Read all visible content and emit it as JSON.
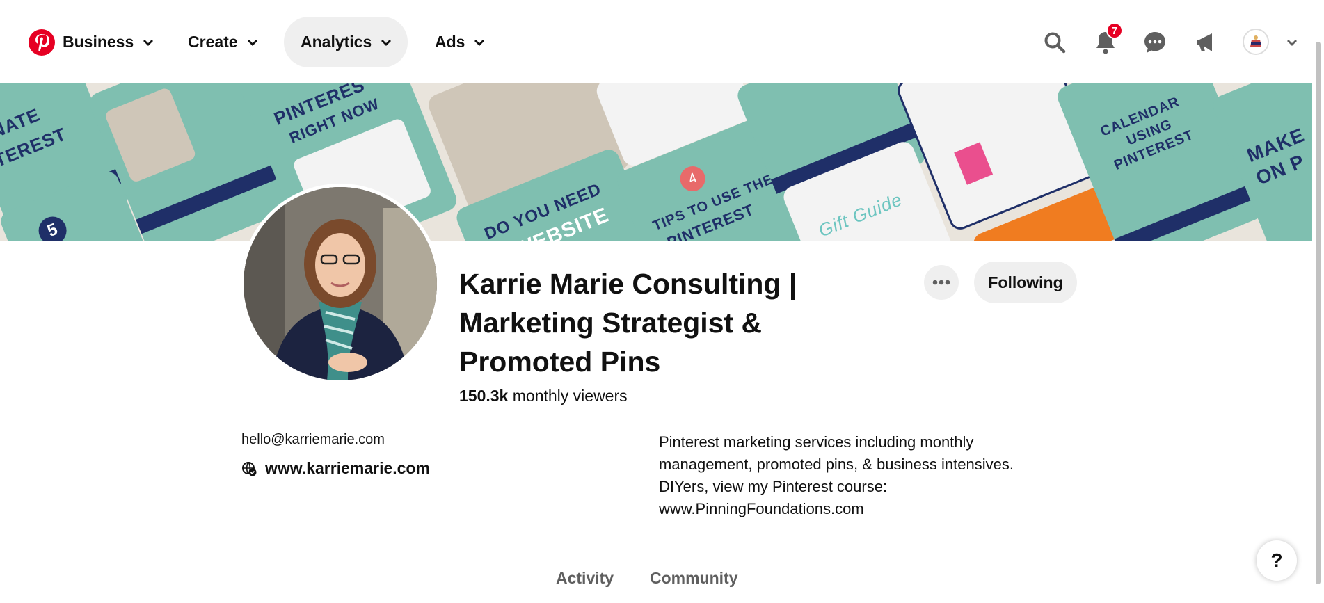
{
  "nav": {
    "business": "Business",
    "create": "Create",
    "analytics": "Analytics",
    "ads": "Ads",
    "notification_count": "7"
  },
  "banner": {
    "tile_texts": [
      "IMINATE",
      "INTEREST",
      "PINTERES",
      "RIGHT NOW",
      "DO YOU NEED",
      "A WEBSITE",
      "TIPS TO USE THE",
      "PINTEREST",
      "CALENDAR",
      "USING",
      "PINTEREST",
      "MAKE",
      "ON P",
      "5",
      "4",
      "Gift Guide"
    ]
  },
  "profile": {
    "name": "Karrie Marie Consulting | Marketing Strategist & Promoted Pins",
    "viewers_count": "150.3k",
    "viewers_label": "monthly viewers",
    "following_button": "Following",
    "email": "hello@karriemarie.com",
    "website": "www.karriemarie.com",
    "bio": "Pinterest marketing services including monthly management, promoted pins, & business intensives. DIYers, view my Pinterest course: www.PinningFoundations.com"
  },
  "tabs": {
    "activity": "Activity",
    "community": "Community"
  },
  "help": "?",
  "colors": {
    "brand_red": "#e60023",
    "teal": "#7fbfb0",
    "navy": "#1f2f68"
  },
  "icons": [
    "pinterest-logo-icon",
    "chevron-down-icon",
    "search-icon",
    "bell-icon",
    "message-icon",
    "megaphone-icon",
    "globe-verified-icon",
    "more-dots-icon"
  ]
}
